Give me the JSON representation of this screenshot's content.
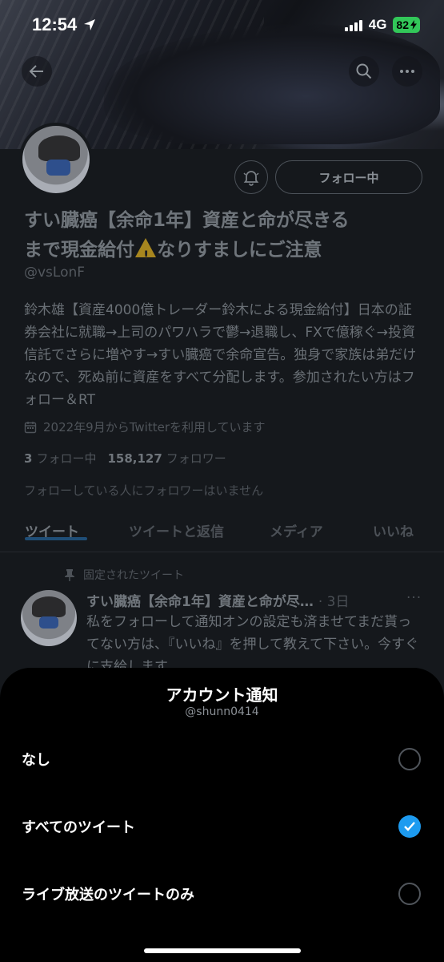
{
  "status": {
    "time": "12:54",
    "network": "4G",
    "battery": "82"
  },
  "profile": {
    "follow_button": "フォロー中",
    "name_line1": "すい臓癌【余命1年】資産と命が尽きる",
    "name_line2_a": "まで現金給付",
    "name_line2_b": "なりすましにご注意",
    "handle": "@vsLonF",
    "bio": "鈴木雄【資産4000億トレーダー鈴木による現金給付】日本の証券会社に就職→上司のパワハラで鬱→退職し、FXで億稼ぐ→投資信託でさらに増やす→すい臓癌で余命宣告。独身で家族は弟だけなので、死ぬ前に資産をすべて分配します。参加されたい方はフォロー＆RT",
    "joined": "2022年9月からTwitterを利用しています",
    "following_count": "3",
    "following_label": "フォロー中",
    "followers_count": "158,127",
    "followers_label": "フォロワー",
    "no_mutual": "フォローしている人にフォロワーはいません"
  },
  "tabs": [
    {
      "label": "ツイート",
      "active": true
    },
    {
      "label": "ツイートと返信",
      "active": false
    },
    {
      "label": "メディア",
      "active": false
    },
    {
      "label": "いいね",
      "active": false
    }
  ],
  "pinned_tweet": {
    "pinned_label": "固定されたツイート",
    "author": "すい臓癌【余命1年】資産と命が尽…",
    "time": "· 3日",
    "text": "私をフォローして通知オンの設定も済ませてまだ貰ってない方は、『いいね』を押して教えて下さい。今すぐに支給します。"
  },
  "sheet": {
    "title": "アカウント通知",
    "subtitle": "@shunn0414",
    "options": [
      {
        "label": "なし",
        "selected": false
      },
      {
        "label": "すべてのツイート",
        "selected": true
      },
      {
        "label": "ライブ放送のツイートのみ",
        "selected": false
      }
    ]
  },
  "colors": {
    "accent": "#1d9bf0",
    "sheet_bg": "#000000",
    "dim_bg": "#15181c"
  }
}
